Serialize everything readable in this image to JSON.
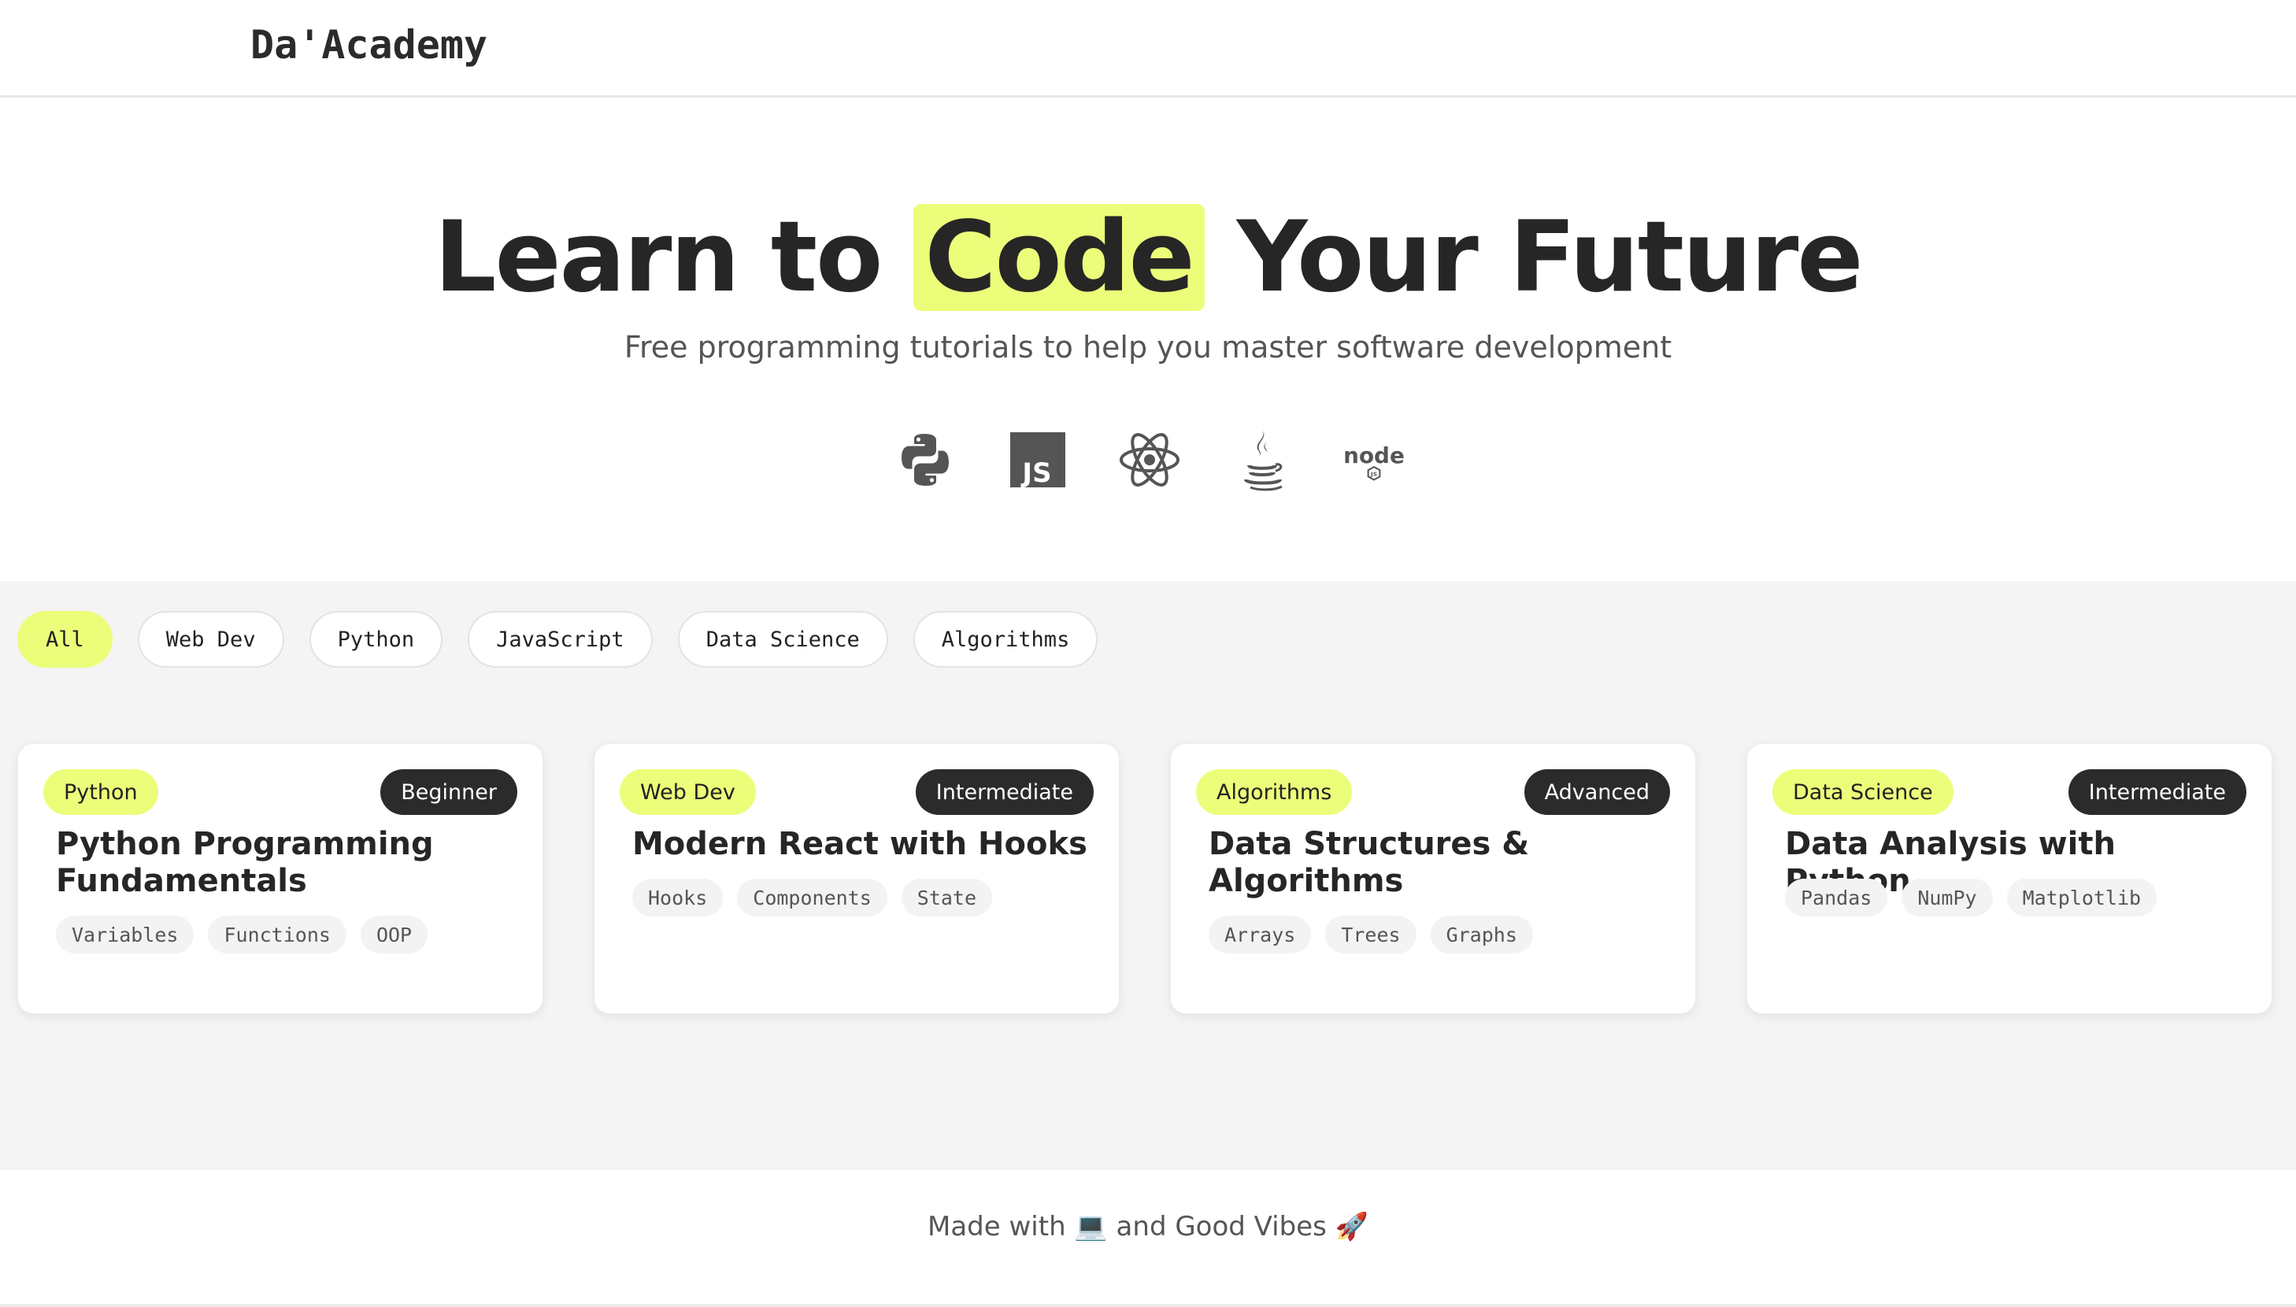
{
  "brand": {
    "name": "Da'Academy"
  },
  "hero": {
    "title_before": "Learn to",
    "title_highlight": "Code",
    "title_after": "Your Future",
    "subtitle": "Free programming tutorials to help you master software development",
    "highlight_color": "#ecfd7a",
    "tech_icons": [
      "python-icon",
      "javascript-icon",
      "react-icon",
      "java-icon",
      "nodejs-icon"
    ]
  },
  "filters": {
    "active": "All",
    "items": [
      "All",
      "Web Dev",
      "Python",
      "JavaScript",
      "Data Science",
      "Algorithms"
    ]
  },
  "courses": [
    {
      "category": "Python",
      "level": "Beginner",
      "title": "Python Programming Fundamentals",
      "tags": [
        "Variables",
        "Functions",
        "OOP"
      ]
    },
    {
      "category": "Web Dev",
      "level": "Intermediate",
      "title": "Modern React with Hooks",
      "tags": [
        "Hooks",
        "Components",
        "State"
      ]
    },
    {
      "category": "Algorithms",
      "level": "Advanced",
      "title": "Data Structures & Algorithms",
      "tags": [
        "Arrays",
        "Trees",
        "Graphs"
      ]
    },
    {
      "category": "Data Science",
      "level": "Intermediate",
      "title": "Data Analysis with Python",
      "tags": [
        "Pandas",
        "NumPy",
        "Matplotlib"
      ]
    }
  ],
  "footer": {
    "text": "Made with 💻 and Good Vibes 🚀"
  },
  "colors": {
    "accent": "#ecfd7a",
    "dark": "#2b2b2b",
    "section_bg": "#f4f4f4"
  }
}
